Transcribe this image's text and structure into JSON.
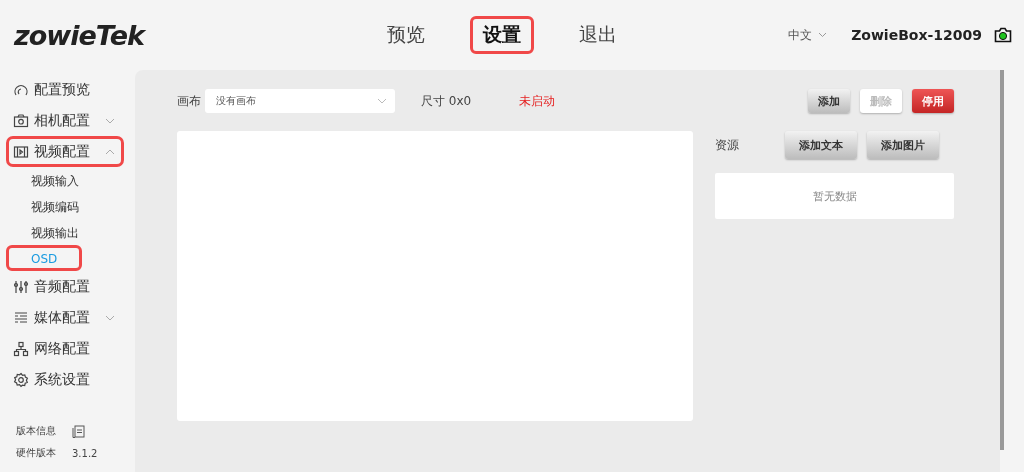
{
  "header": {
    "logo": "zowieTek",
    "nav": [
      {
        "label": "预览",
        "selected": false,
        "highlighted": false
      },
      {
        "label": "设置",
        "selected": true,
        "highlighted": true
      },
      {
        "label": "退出",
        "selected": false,
        "highlighted": false
      }
    ],
    "language": "中文",
    "device_name": "ZowieBox-12009"
  },
  "sidebar": {
    "items": [
      {
        "label": "配置预览",
        "kind": "preview",
        "expandable": false,
        "highlighted": false
      },
      {
        "label": "相机配置",
        "kind": "camera",
        "expandable": true,
        "expanded": false,
        "highlighted": false
      },
      {
        "label": "视频配置",
        "kind": "film",
        "expandable": true,
        "expanded": true,
        "highlighted": true,
        "children": [
          {
            "label": "视频输入",
            "selected": false,
            "highlighted": false
          },
          {
            "label": "视频编码",
            "selected": false,
            "highlighted": false
          },
          {
            "label": "视频输出",
            "selected": false,
            "highlighted": false
          },
          {
            "label": "OSD",
            "selected": true,
            "highlighted": true
          }
        ]
      },
      {
        "label": "音频配置",
        "kind": "sliders",
        "expandable": false,
        "highlighted": false
      },
      {
        "label": "媒体配置",
        "kind": "media",
        "expandable": true,
        "expanded": false,
        "highlighted": false
      },
      {
        "label": "网络配置",
        "kind": "network",
        "expandable": false,
        "highlighted": false
      },
      {
        "label": "系统设置",
        "kind": "gear",
        "expandable": false,
        "highlighted": false
      }
    ],
    "version_title": "版本信息",
    "versions": [
      {
        "label": "硬件版本",
        "value": "3.1.2"
      }
    ]
  },
  "toolbar": {
    "canvas_label": "画布",
    "canvas_select": "没有画布",
    "size": "尺寸 0x0",
    "status": "未启动",
    "buttons": [
      {
        "label": "添加",
        "kind": "normal",
        "disabled": false
      },
      {
        "label": "删除",
        "kind": "normal",
        "disabled": true
      },
      {
        "label": "停用",
        "kind": "danger",
        "disabled": false
      }
    ]
  },
  "resources": {
    "label": "资源",
    "buttons": [
      "添加文本",
      "添加图片"
    ],
    "empty": "暂无数据"
  }
}
